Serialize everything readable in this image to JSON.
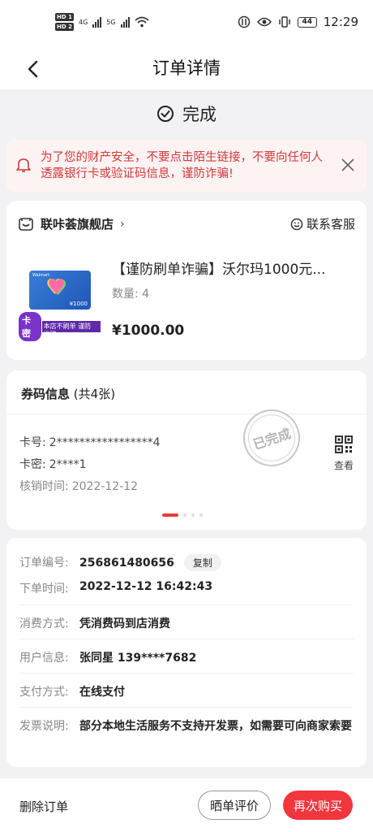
{
  "statusbar": {
    "hd1": "HD 1",
    "hd2": "HD 2",
    "net1": "4G",
    "net2": "5G",
    "battery": "44",
    "time": "12:29"
  },
  "header": {
    "title": "订单详情"
  },
  "order_status": "完成",
  "warning": {
    "text": "为了您的财产安全，不要点击陌生链接，不要向任何人透露银行卡或验证码信息，谨防诈骗!"
  },
  "store": {
    "name": "联咔荟旗舰店",
    "chevron": "›",
    "service_label": "联系客服",
    "product_title": "【谨防刷单诈骗】沃尔玛1000元...",
    "quantity": "数量: 4",
    "price": "¥1000.00",
    "thumb": {
      "brand": "Walmart",
      "amount": "¥1000",
      "tag_badge": "卡密",
      "tag_text": "本店不刷单 谨防诈骗"
    }
  },
  "coupon": {
    "title": "券码信息",
    "count": "(共4张)",
    "card_no_label": "卡号:",
    "card_no": "2*****************4",
    "card_pwd_label": "卡密:",
    "card_pwd": "2****1",
    "verify_label": "核销时间:",
    "verify_time": "2022-12-12",
    "stamp": "已完成",
    "view_label": "查看"
  },
  "details": {
    "order_no_label": "订单编号:",
    "order_no": "256861480656",
    "copy_label": "复制",
    "order_time_label": "下单时间:",
    "order_time": "2022-12-12 16:42:43",
    "consume_label": "消费方式:",
    "consume": "凭消费码到店消费",
    "user_label": "用户信息:",
    "user": "张同星 139****7682",
    "pay_label": "支付方式:",
    "pay": "在线支付",
    "invoice_label": "发票说明:",
    "invoice": "部分本地生活服务不支持开发票，如需要可向商家索要"
  },
  "footer": {
    "delete_label": "删除订单",
    "review_label": "晒单评价",
    "rebuy_label": "再次购买"
  },
  "colors": {
    "accent_red": "#f2363e",
    "warning_text": "#d03b3b",
    "warning_bg": "#fdf3f3",
    "page_bg": "#f2f2f4"
  }
}
